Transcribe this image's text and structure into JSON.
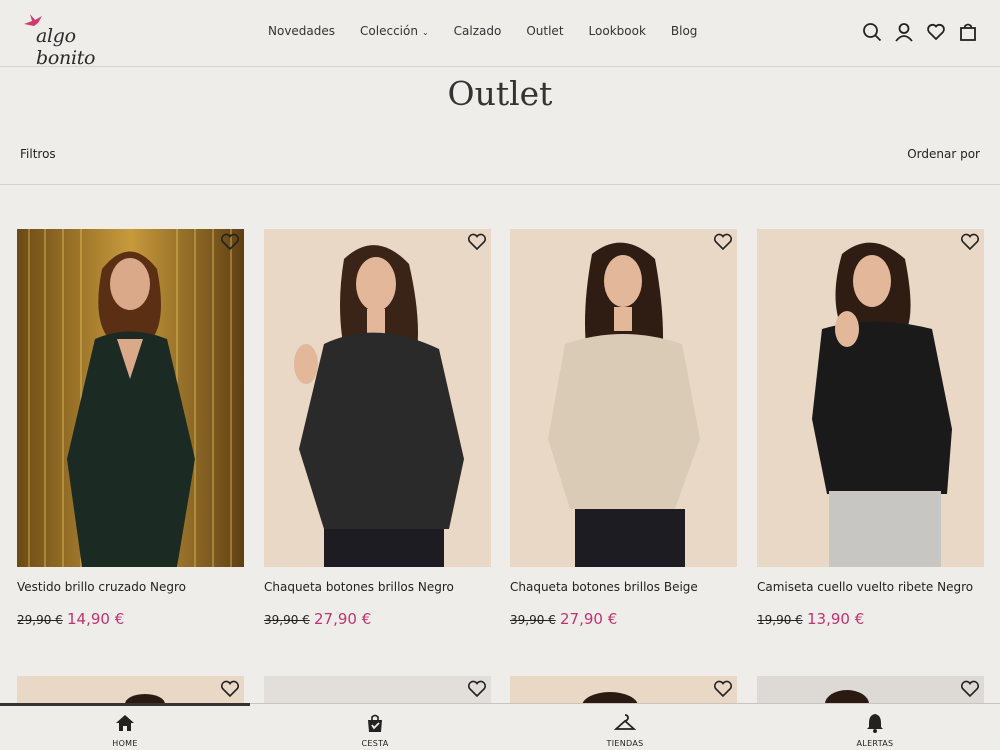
{
  "brand": {
    "name": "algo bonito"
  },
  "nav": [
    {
      "label": "Novedades"
    },
    {
      "label": "Colección"
    },
    {
      "label": "Calzado"
    },
    {
      "label": "Outlet"
    },
    {
      "label": "Lookbook"
    },
    {
      "label": "Blog"
    }
  ],
  "page": {
    "title": "Outlet",
    "filters_label": "Filtros",
    "sort_label": "Ordenar por"
  },
  "products": [
    {
      "name": "Vestido brillo cruzado Negro",
      "old_price": "29,90 €",
      "new_price": "14,90 €"
    },
    {
      "name": "Chaqueta botones brillos Negro",
      "old_price": "39,90 €",
      "new_price": "27,90 €"
    },
    {
      "name": "Chaqueta botones brillos Beige",
      "old_price": "39,90 €",
      "new_price": "27,90 €"
    },
    {
      "name": "Camiseta cuello vuelto ribete Negro",
      "old_price": "19,90 €",
      "new_price": "13,90 €"
    }
  ],
  "bottom_nav": [
    {
      "label": "HOME"
    },
    {
      "label": "CESTA"
    },
    {
      "label": "TIENDAS"
    },
    {
      "label": "ALERTAS"
    }
  ],
  "colors": {
    "sale": "#c0346f",
    "background": "#efedea",
    "accent_logo": "#d23a6d"
  }
}
